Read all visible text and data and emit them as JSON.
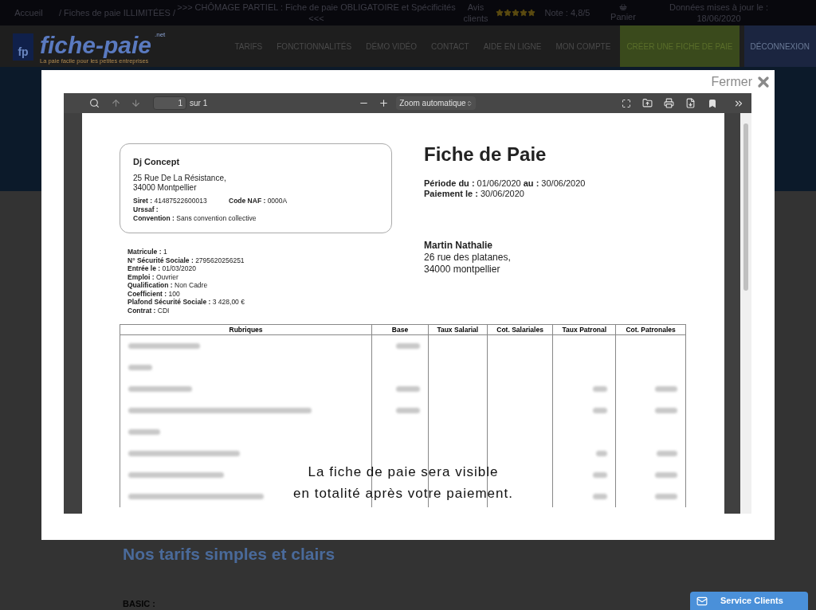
{
  "top_bar": {
    "links": [
      "Accueil",
      "/ Fiches de paie ILLIMITÉES /",
      ">>> CHÔMAGE PARTIEL : Fiche de paie OBLIGATOIRE et Spécificités <<<"
    ],
    "reviews_label": "Avis clients",
    "stars": 5,
    "rating": "Note : 4,8/5",
    "cart": "Panier",
    "updated": "Données mises à jour le : 18/06/2020"
  },
  "header": {
    "logo_badge": "fp",
    "logo_text": "fiche-paie",
    "logo_suffix": ".net",
    "logo_tagline": "La paie facile pour les petites entreprises",
    "nav": [
      {
        "label": "TARIFS",
        "kind": "link"
      },
      {
        "label": "FONCTIONNALITÉS",
        "kind": "link"
      },
      {
        "label": "DÉMO VIDÉO",
        "kind": "link"
      },
      {
        "label": "CONTACT",
        "kind": "link"
      },
      {
        "label": "AIDE EN LIGNE",
        "kind": "link"
      },
      {
        "label": "MON COMPTE",
        "kind": "link"
      },
      {
        "label": "CRÉER UNE FICHE DE PAIE",
        "kind": "cta"
      },
      {
        "label": "DÉCONNEXION",
        "kind": "logout"
      }
    ]
  },
  "modal": {
    "close_label": "Fermer",
    "viewer": {
      "page_number": "1",
      "page_count": "sur 1",
      "zoom": "Zoom automatique"
    },
    "document": {
      "company": {
        "name": "Dj Concept",
        "address": [
          "25 Rue De La Résistance,",
          "34000 Montpellier"
        ],
        "siret": "**Siret :** 41487522600013",
        "naf": "**Code NAF :** 0000A",
        "urssaf": "**Urssaf :**",
        "convention": "**Convention :** Sans convention collective"
      },
      "title": "Fiche de Paie",
      "period": "**Période du :** 01/06/2020 **au :** 30/06/2020",
      "payment": "**Paiement le :** 30/06/2020",
      "employee_info": [
        "**Matricule :** 1",
        "**N° Sécurité Sociale :** 2795620256251",
        "**Entrée le :** 01/03/2020",
        "**Emploi :** Ouvrier",
        "**Qualification :** Non Cadre",
        "**Coefficient :** 100",
        "**Plafond Sécurité Sociale :** 3 428,00 €",
        "**Contrat :** CDI"
      ],
      "employee": {
        "name": "Martin Nathalie",
        "address": [
          "26 rue des platanes,",
          "34000 montpellier"
        ]
      },
      "table_columns": [
        "Rubriques",
        "Base",
        "Taux Salarial",
        "Cot. Salariales",
        "Taux Patronal",
        "Cot. Patronales"
      ],
      "notice": [
        "La fiche de paie sera visible",
        "en totalité après votre paiement."
      ]
    }
  },
  "page": {
    "heading": "Nos tarifs simples et clairs",
    "plan": "BASIC :"
  },
  "support_button": "Service Clients"
}
